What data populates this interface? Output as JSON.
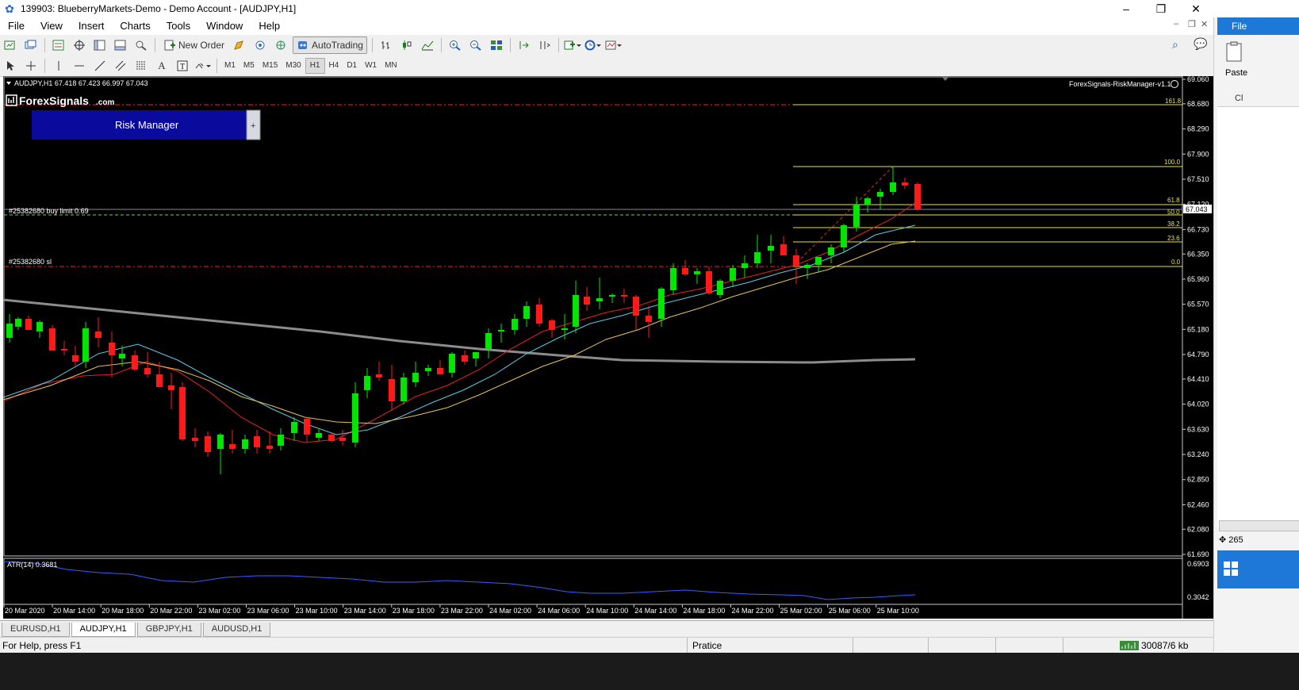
{
  "window": {
    "title": "139903: BlueberryMarkets-Demo - Demo Account - [AUDJPY,H1]"
  },
  "menu": [
    "File",
    "View",
    "Insert",
    "Charts",
    "Tools",
    "Window",
    "Help"
  ],
  "toolbar": {
    "new_order": "New Order",
    "autotrading": "AutoTrading"
  },
  "timeframes": [
    "M1",
    "M5",
    "M15",
    "M30",
    "H1",
    "H4",
    "D1",
    "W1",
    "MN"
  ],
  "chart": {
    "header": "AUDJPY,H1  67.418 67.423 66.997 67.043",
    "brand": "ForexSignals",
    "brand_suffix": ".com",
    "risk_manager_label": "Risk Manager",
    "risk_manager_plus": "+",
    "ea_name": "ForexSignals-RiskManager-v1.1",
    "buy_limit_label": "#25382680 buy limit 0.69",
    "sl_label": "#25382680 sl",
    "current_price": "67.043",
    "price_levels": [
      "69.060",
      "68.680",
      "68.290",
      "67.900",
      "67.510",
      "67.120",
      "66.730",
      "66.350",
      "65.960",
      "65.570",
      "65.180",
      "64.790",
      "64.410",
      "64.020",
      "63.630",
      "63.240",
      "62.850",
      "62.460",
      "62.080",
      "61.690"
    ],
    "fib_levels": [
      "161.8",
      "100.0",
      "61.8",
      "50.0",
      "38.2",
      "23.6",
      "0.0"
    ],
    "atr_label": "ATR(14) 0.3681",
    "atr_levels": [
      "0.6903",
      "0.3042"
    ],
    "time_labels": [
      "20 Mar 2020",
      "20 Mar 14:00",
      "20 Mar 18:00",
      "20 Mar 22:00",
      "23 Mar 02:00",
      "23 Mar 06:00",
      "23 Mar 10:00",
      "23 Mar 14:00",
      "23 Mar 18:00",
      "23 Mar 22:00",
      "24 Mar 02:00",
      "24 Mar 06:00",
      "24 Mar 10:00",
      "24 Mar 14:00",
      "24 Mar 18:00",
      "24 Mar 22:00",
      "25 Mar 02:00",
      "25 Mar 06:00",
      "25 Mar 10:00"
    ]
  },
  "tabs": [
    "EURUSD,H1",
    "AUDJPY,H1",
    "GBPJPY,H1",
    "AUDUSD,H1"
  ],
  "active_tab": "AUDJPY,H1",
  "status": {
    "help": "For Help, press F1",
    "profile": "Pratice",
    "traffic": "30087/6 kb"
  },
  "right_panel": {
    "file_tab": "File",
    "paste": "Paste",
    "cl": "Cl",
    "num": "265"
  },
  "colors": {
    "bull": "#00e600",
    "bear": "#ff1a1a",
    "fib": "#e6e24a",
    "ma_fast": "#e22222",
    "ma_mid": "#5fc9e8",
    "ma_slow": "#e6c15a",
    "ma_long": "#8c8c8c",
    "atr": "#3b5cff",
    "risk_panel": "#0a0a9c"
  }
}
